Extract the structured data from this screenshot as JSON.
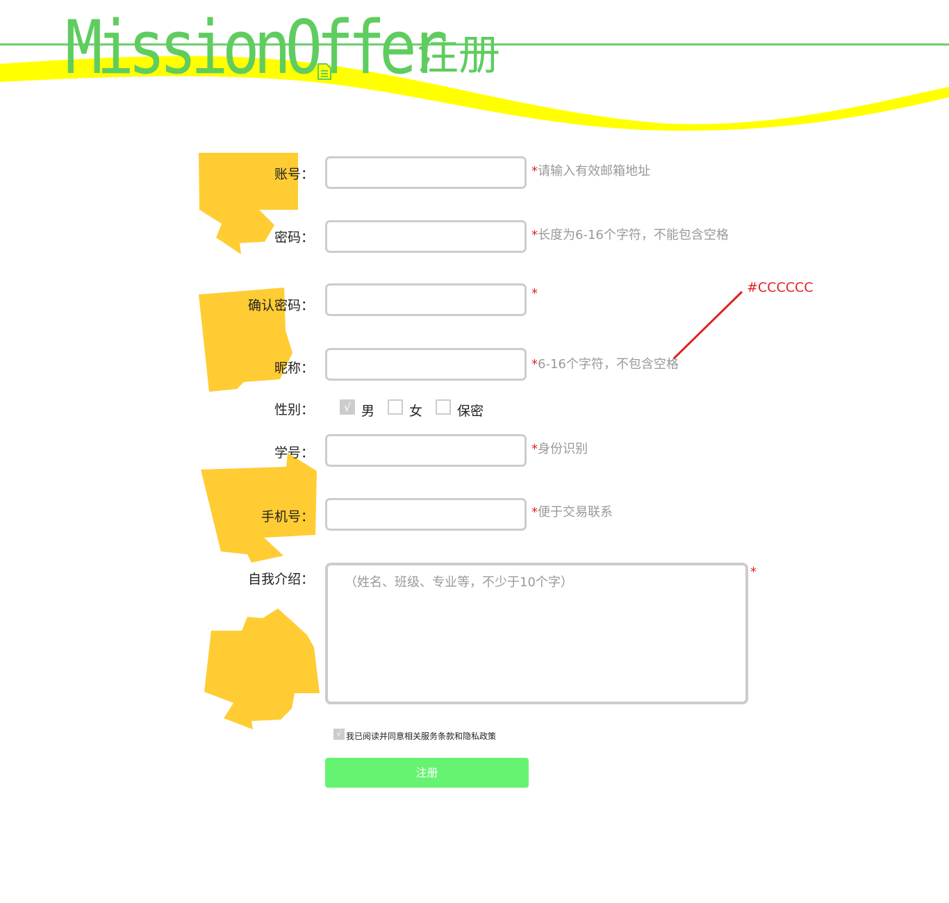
{
  "header": {
    "logo": "MissionOffer",
    "subtitle": "注册",
    "colors": {
      "brand_green": "#5fcc5f",
      "wave_yellow": "#ffff00",
      "rule_green": "#66cc66"
    }
  },
  "form": {
    "required_mark": "*",
    "fields": {
      "account": {
        "label": "账号：",
        "hint": "请输入有效邮箱地址"
      },
      "password": {
        "label": "密码：",
        "hint": "长度为6-16个字符，不能包含空格"
      },
      "confirm": {
        "label": "确认密码：",
        "hint": ""
      },
      "nickname": {
        "label": "昵称：",
        "hint": "6-16个字符，不包含空格"
      },
      "student_id": {
        "label": "学号：",
        "hint": "身份识别"
      },
      "phone": {
        "label": "手机号：",
        "hint": "便于交易联系"
      },
      "intro": {
        "label": "自我介绍：",
        "placeholder": "（姓名、班级、专业等，不少于10个字）"
      }
    },
    "gender": {
      "label": "性别：",
      "options": [
        "男",
        "女",
        "保密"
      ],
      "selected": "男",
      "check_glyph": "√"
    },
    "agreement": {
      "text": "我已阅读并同意相关服务条款和隐私政策",
      "checked": true,
      "check_glyph": "√"
    },
    "submit_label": "注册",
    "colors": {
      "border": "#cccccc",
      "submit_bg": "#66f371",
      "required": "#e02020",
      "hint": "#999999"
    }
  },
  "annotation": {
    "text": "#CCCCCC",
    "color": "#e02020"
  },
  "decor": {
    "blob_color": "#ffcc33"
  }
}
